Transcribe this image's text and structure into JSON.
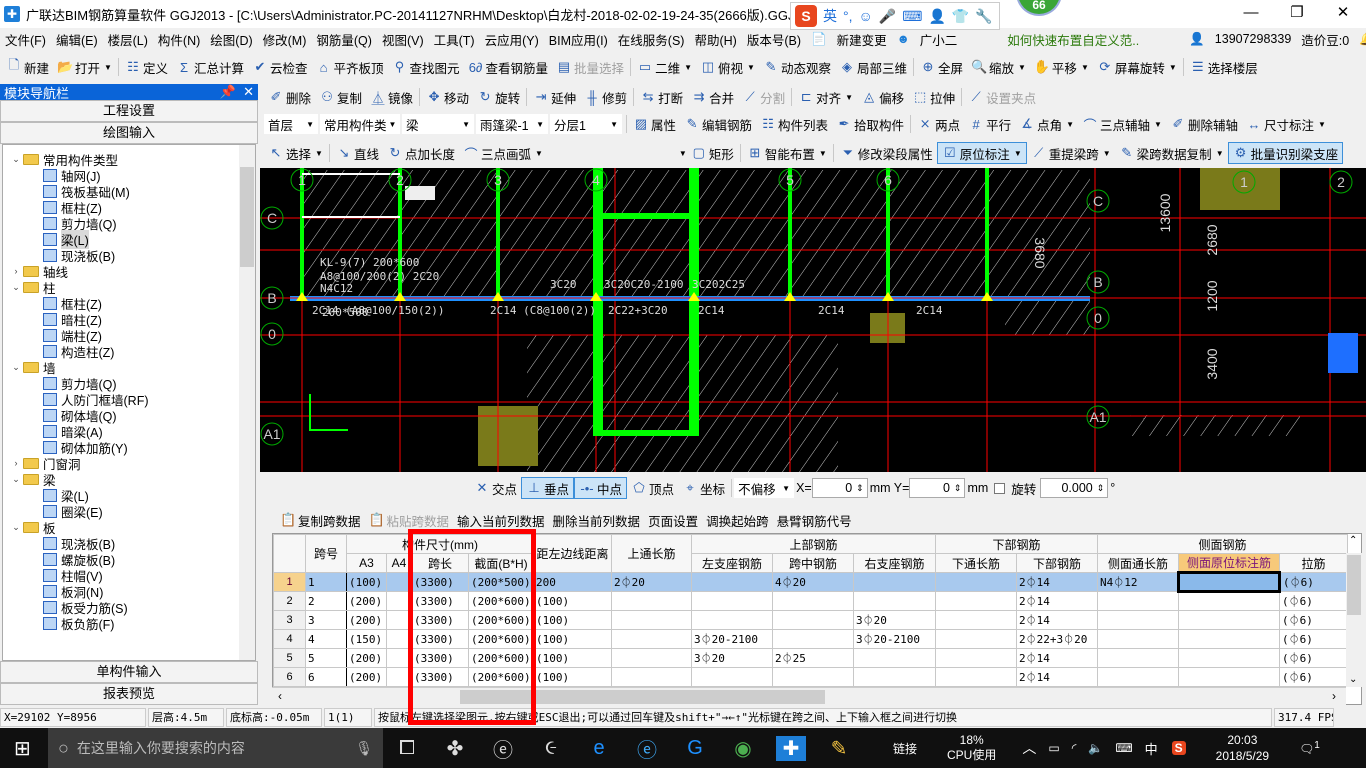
{
  "window": {
    "title": "广联达BIM钢筋算量软件 GGJ2013 - [C:\\Users\\Administrator.PC-20141127NRHM\\Desktop\\白龙村-2018-02-02-19-24-35(2666版).GGJ12]",
    "badge": "66",
    "ime": {
      "mode": "英",
      "punct": "°,"
    }
  },
  "menu": [
    "文件(F)",
    "编辑(E)",
    "楼层(L)",
    "构件(N)",
    "绘图(D)",
    "修改(M)",
    "钢筋量(Q)",
    "视图(V)",
    "工具(T)",
    "云应用(Y)",
    "BIM应用(I)",
    "在线服务(S)",
    "帮助(H)",
    "版本号(B)"
  ],
  "menu_extras": {
    "new_change": "新建变更",
    "assistant": "广小二",
    "tip_link": "如何快速布置自定义范..",
    "phone": "13907298339",
    "beans": "造价豆:0"
  },
  "toolbar1": [
    {
      "label": "新建",
      "icon": "new-file",
      "glyph": "🗋"
    },
    {
      "label": "打开",
      "icon": "open-folder",
      "glyph": "📂",
      "dropdown": true
    },
    {
      "sep": true
    },
    {
      "label": "定义",
      "icon": "define",
      "glyph": "☷"
    },
    {
      "label": "汇总计算",
      "icon": "sigma",
      "glyph": "Σ"
    },
    {
      "label": "云检查",
      "icon": "cloud-check",
      "glyph": "✔"
    },
    {
      "label": "平齐板顶",
      "icon": "align-top",
      "glyph": "⌂"
    },
    {
      "label": "查找图元",
      "icon": "binoculars",
      "glyph": "⚲"
    },
    {
      "label": "查看钢筋量",
      "icon": "view-rebar",
      "glyph": "6∂"
    },
    {
      "label": "批量选择",
      "icon": "batch-select",
      "glyph": "▤",
      "disabled": true
    },
    {
      "sep": true
    },
    {
      "label": "二维",
      "icon": "2d-view",
      "glyph": "▭",
      "dropdown": true
    },
    {
      "label": "俯视",
      "icon": "top-view",
      "glyph": "◫",
      "dropdown": true
    },
    {
      "label": "动态观察",
      "icon": "orbit",
      "glyph": "✎"
    },
    {
      "label": "局部三维",
      "icon": "local-3d",
      "glyph": "◈"
    },
    {
      "sep": true
    },
    {
      "label": "全屏",
      "icon": "fullscreen",
      "glyph": "⊕"
    },
    {
      "label": "缩放",
      "icon": "zoom",
      "glyph": "🔍",
      "dropdown": true
    },
    {
      "label": "平移",
      "icon": "pan",
      "glyph": "✋",
      "dropdown": true
    },
    {
      "label": "屏幕旋转",
      "icon": "rotate-screen",
      "glyph": "⟳",
      "dropdown": true
    },
    {
      "sep": true
    },
    {
      "label": "选择楼层",
      "icon": "select-floor",
      "glyph": "☰"
    }
  ],
  "toolbar2": [
    {
      "label": "删除",
      "icon": "delete",
      "glyph": "✐"
    },
    {
      "label": "复制",
      "icon": "copy",
      "glyph": "⚇"
    },
    {
      "label": "镜像",
      "icon": "mirror",
      "glyph": "⏅"
    },
    {
      "sep": true
    },
    {
      "label": "移动",
      "icon": "move",
      "glyph": "✥"
    },
    {
      "label": "旋转",
      "icon": "rotate",
      "glyph": "↻"
    },
    {
      "sep": true
    },
    {
      "label": "延伸",
      "icon": "extend",
      "glyph": "⇥"
    },
    {
      "label": "修剪",
      "icon": "trim",
      "glyph": "╫"
    },
    {
      "sep": true
    },
    {
      "label": "打断",
      "icon": "break",
      "glyph": "⇆"
    },
    {
      "label": "合并",
      "icon": "merge",
      "glyph": "⇉"
    },
    {
      "label": "分割",
      "icon": "split",
      "glyph": "⟋",
      "disabled": true
    },
    {
      "sep": true
    },
    {
      "label": "对齐",
      "icon": "align",
      "glyph": "⊏",
      "dropdown": true
    },
    {
      "label": "偏移",
      "icon": "offset",
      "glyph": "◬"
    },
    {
      "label": "拉伸",
      "icon": "stretch",
      "glyph": "⬚"
    },
    {
      "sep": true
    },
    {
      "label": "设置夹点",
      "icon": "grip-point",
      "glyph": "⟋",
      "disabled": true
    }
  ],
  "selectors": [
    {
      "name": "floor",
      "value": "首层"
    },
    {
      "name": "category",
      "value": "常用构件类"
    },
    {
      "name": "type",
      "value": "梁"
    },
    {
      "name": "component",
      "value": "雨篷梁-1"
    },
    {
      "name": "layer",
      "value": "分层1"
    }
  ],
  "toolbar3": [
    {
      "label": "属性",
      "icon": "properties",
      "glyph": "▨"
    },
    {
      "label": "编辑钢筋",
      "icon": "edit-rebar",
      "glyph": "✎"
    },
    {
      "label": "构件列表",
      "icon": "component-list",
      "glyph": "☷"
    },
    {
      "label": "拾取构件",
      "icon": "pick-component",
      "glyph": "✒"
    },
    {
      "sep": true
    },
    {
      "label": "两点",
      "icon": "two-point",
      "glyph": "⨯"
    },
    {
      "label": "平行",
      "icon": "parallel",
      "glyph": "#"
    },
    {
      "label": "点角",
      "icon": "point-angle",
      "glyph": "∡",
      "dropdown": true
    },
    {
      "label": "三点辅轴",
      "icon": "three-point-axis",
      "glyph": "⌒",
      "dropdown": true
    },
    {
      "label": "删除辅轴",
      "icon": "delete-axis",
      "glyph": "✐"
    },
    {
      "label": "尺寸标注",
      "icon": "dimension",
      "glyph": "↔",
      "dropdown": true
    }
  ],
  "toolbar4": [
    {
      "label": "选择",
      "icon": "select-cursor",
      "glyph": "↖",
      "dropdown": true
    },
    {
      "sep": true
    },
    {
      "label": "直线",
      "icon": "line",
      "glyph": "↘"
    },
    {
      "label": "点加长度",
      "icon": "point-length",
      "glyph": "↻"
    },
    {
      "label": "三点画弧",
      "icon": "arc",
      "glyph": "⌒",
      "dropdown": true
    },
    {
      "spacer": true
    },
    {
      "label": "矩形",
      "icon": "rectangle",
      "glyph": "▢"
    },
    {
      "sep": true
    },
    {
      "label": "智能布置",
      "icon": "smart-layout",
      "glyph": "⊞",
      "dropdown": true
    },
    {
      "sep": true
    },
    {
      "label": "修改梁段属性",
      "icon": "edit-beam-segment",
      "glyph": "⏷"
    },
    {
      "label": "原位标注",
      "icon": "in-situ-annotation",
      "glyph": "☑",
      "active": true,
      "dropdown": true
    },
    {
      "label": "重提梁跨",
      "icon": "re-extract-span",
      "glyph": "⟋",
      "dropdown": true
    },
    {
      "label": "梁跨数据复制",
      "icon": "copy-span-data",
      "glyph": "✎",
      "dropdown": true
    },
    {
      "label": "批量识别梁支座",
      "icon": "batch-identify-support",
      "glyph": "⚙",
      "active": true
    }
  ],
  "nav": {
    "title": "模块导航栏",
    "sections_top": [
      "工程设置",
      "绘图输入"
    ],
    "sections_bottom": [
      "单构件输入",
      "报表预览"
    ],
    "tree": [
      {
        "label": "常用构件类型",
        "level": 0,
        "open": true
      },
      {
        "label": "轴网(J)",
        "level": 1
      },
      {
        "label": "筏板基础(M)",
        "level": 1
      },
      {
        "label": "框柱(Z)",
        "level": 1
      },
      {
        "label": "剪力墙(Q)",
        "level": 1
      },
      {
        "label": "梁(L)",
        "level": 1,
        "selected": true
      },
      {
        "label": "现浇板(B)",
        "level": 1
      },
      {
        "label": "轴线",
        "level": 0,
        "open": false
      },
      {
        "label": "柱",
        "level": 0,
        "open": true
      },
      {
        "label": "框柱(Z)",
        "level": 1
      },
      {
        "label": "暗柱(Z)",
        "level": 1
      },
      {
        "label": "端柱(Z)",
        "level": 1
      },
      {
        "label": "构造柱(Z)",
        "level": 1
      },
      {
        "label": "墙",
        "level": 0,
        "open": true
      },
      {
        "label": "剪力墙(Q)",
        "level": 1
      },
      {
        "label": "人防门框墙(RF)",
        "level": 1
      },
      {
        "label": "砌体墙(Q)",
        "level": 1
      },
      {
        "label": "暗梁(A)",
        "level": 1
      },
      {
        "label": "砌体加筋(Y)",
        "level": 1
      },
      {
        "label": "门窗洞",
        "level": 0,
        "open": false
      },
      {
        "label": "梁",
        "level": 0,
        "open": true
      },
      {
        "label": "梁(L)",
        "level": 1
      },
      {
        "label": "圈梁(E)",
        "level": 1
      },
      {
        "label": "板",
        "level": 0,
        "open": true
      },
      {
        "label": "现浇板(B)",
        "level": 1
      },
      {
        "label": "螺旋板(B)",
        "level": 1
      },
      {
        "label": "柱帽(V)",
        "level": 1
      },
      {
        "label": "板洞(N)",
        "level": 1
      },
      {
        "label": "板受力筋(S)",
        "level": 1
      },
      {
        "label": "板负筋(F)",
        "level": 1
      }
    ]
  },
  "canvas": {
    "axis_labels": [
      "1",
      "2",
      "3",
      "4",
      "5",
      "6",
      "C",
      "B",
      "0",
      "A1",
      "C",
      "B",
      "0",
      "A1",
      "1",
      "2"
    ],
    "dimensions": [
      "13600",
      "2680",
      "1200",
      "3400",
      "3680"
    ],
    "annotations": [
      "KL-9(7) 200*600",
      "A8@100/200(2) 2C20",
      "N4C12",
      "200*500",
      "2C14 (A8@100/150(2))",
      "2C14 (C8@100(2))",
      "2C22+3C20",
      "2C14",
      "2C14",
      "2C14",
      "3C20",
      "3C20C20-2100",
      "3C202C25"
    ],
    "colors": {
      "background": "#000000",
      "column": "#00ff00",
      "grid": "#ff0000",
      "beam": "#1e90ff",
      "hatch": "#ffffff",
      "support": "#ffff00"
    }
  },
  "snapbar": {
    "items": [
      {
        "label": "交点",
        "icon": "intersection"
      },
      {
        "label": "垂点",
        "icon": "perpendicular",
        "active": true
      },
      {
        "label": "中点",
        "icon": "midpoint",
        "active": true
      },
      {
        "label": "顶点",
        "icon": "vertex"
      },
      {
        "label": "坐标",
        "icon": "coordinate"
      }
    ],
    "offset_mode": "不偏移",
    "x_label": "X=",
    "x_value": "0",
    "y_label": "mm Y=",
    "y_value": "0",
    "unit": "mm",
    "rotate_label": "旋转",
    "rotate_value": "0.000",
    "degree": "°"
  },
  "table_tools": [
    {
      "label": "复制跨数据"
    },
    {
      "label": "粘贴跨数据",
      "disabled": true
    },
    {
      "label": "输入当前列数据"
    },
    {
      "label": "删除当前列数据"
    },
    {
      "label": "页面设置"
    },
    {
      "label": "调换起始跨"
    },
    {
      "label": "悬臂钢筋代号"
    }
  ],
  "table": {
    "group_headers": {
      "span_no": "跨号",
      "size": "构件尺寸(mm)",
      "dist": "距左边线距离",
      "top_through": "上通长筋",
      "top": "上部钢筋",
      "bottom": "下部钢筋",
      "side": "侧面钢筋"
    },
    "columns": [
      "A3",
      "A4",
      "跨长",
      "截面(B*H)",
      "左支座钢筋",
      "跨中钢筋",
      "右支座钢筋",
      "下通长筋",
      "下部钢筋",
      "侧面通长筋",
      "侧面原位标注筋",
      "拉筋"
    ],
    "rows": [
      [
        "1",
        "1",
        "(100)",
        "",
        "(3300)",
        "(200*500)",
        "200",
        "2⏀20",
        "",
        "4⏀20",
        "",
        "",
        "2⏀14",
        "N4⏀12",
        "",
        "(⏀6)"
      ],
      [
        "2",
        "2",
        "(200)",
        "",
        "(3300)",
        "(200*600)",
        "(100)",
        "",
        "",
        "",
        "",
        "",
        "2⏀14",
        "",
        "",
        "(⏀6)"
      ],
      [
        "3",
        "3",
        "(200)",
        "",
        "(3300)",
        "(200*600)",
        "(100)",
        "",
        "",
        "",
        "3⏀20",
        "",
        "2⏀14",
        "",
        "",
        "(⏀6)"
      ],
      [
        "4",
        "4",
        "(150)",
        "",
        "(3300)",
        "(200*600)",
        "(100)",
        "",
        "3⏀20-2100",
        "",
        "3⏀20-2100",
        "",
        "2⏀22+3⏀20",
        "",
        "",
        "(⏀6)"
      ],
      [
        "5",
        "5",
        "(200)",
        "",
        "(3300)",
        "(200*600)",
        "(100)",
        "",
        "3⏀20",
        "2⏀25",
        "",
        "",
        "2⏀14",
        "",
        "",
        "(⏀6)"
      ],
      [
        "6",
        "6",
        "(200)",
        "",
        "(3300)",
        "(200*600)",
        "(100)",
        "",
        "",
        "",
        "",
        "",
        "2⏀14",
        "",
        "",
        "(⏀6)"
      ]
    ],
    "selected_row": 1,
    "current_column": "侧面原位标注筋"
  },
  "status": {
    "coords": "X=29102 Y=8956",
    "floor_height": "层高:4.5m",
    "base_elev": "底标高:-0.05m",
    "span": "1(1)",
    "hint": "按鼠标左键选择梁图元,按右键或ESC退出;可以通过回车键及shift+\"→←↑\"光标键在跨之间、上下输入框之间进行切换",
    "fps": "317.4 FPS"
  },
  "taskbar": {
    "search_placeholder": "在这里输入你要搜索的内容",
    "link": "链接",
    "cpu": "18%",
    "cpu_label": "CPU使用",
    "ime": "中",
    "time": "20:03",
    "date": "2018/5/29",
    "notifications": "1"
  },
  "highlight_color": "#ff0000"
}
